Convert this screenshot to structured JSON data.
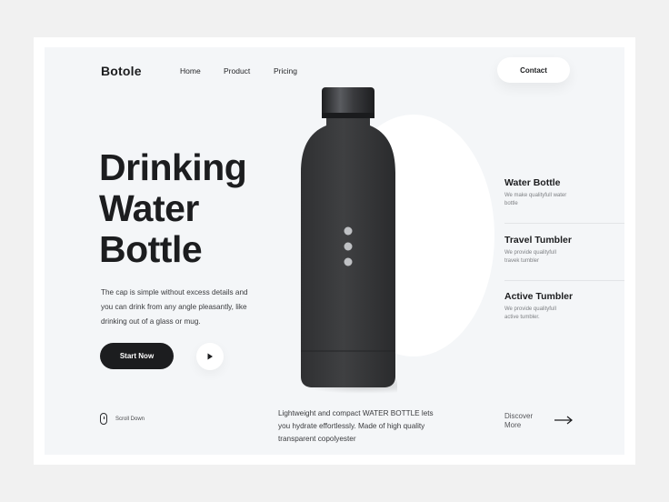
{
  "brand": {
    "logo": "Botole"
  },
  "nav": {
    "home": "Home",
    "product": "Product",
    "pricing": "Pricing",
    "contact": "Contact"
  },
  "hero": {
    "title_line1": "Drinking",
    "title_line2": "Water",
    "title_line3": "Bottle",
    "description": "The cap is simple without excess details and you can drink from any angle pleasantly, like drinking out of a glass or mug.",
    "start_label": "Start Now",
    "scroll_label": "Scroll Down"
  },
  "product_note": "Lightweight and compact WATER BOTTLE lets you hydrate effortlessly. Made of high quality transparent copolyester",
  "categories": [
    {
      "title": "Water Bottle",
      "subtitle": "We make qualityfull water bottle"
    },
    {
      "title": "Travel Tumbler",
      "subtitle": "We provide qualityfull travek tumbler"
    },
    {
      "title": "Active Tumbler",
      "subtitle": "We provide qualityfull active tumbler."
    }
  ],
  "discover": {
    "line1": "Discover",
    "line2": "More"
  },
  "colors": {
    "dark": "#1c1d1f",
    "page_bg": "#f4f6f8",
    "bottle": "#3a3b3d",
    "cap": "#2e2f31",
    "accent_text": "#7e8084"
  }
}
